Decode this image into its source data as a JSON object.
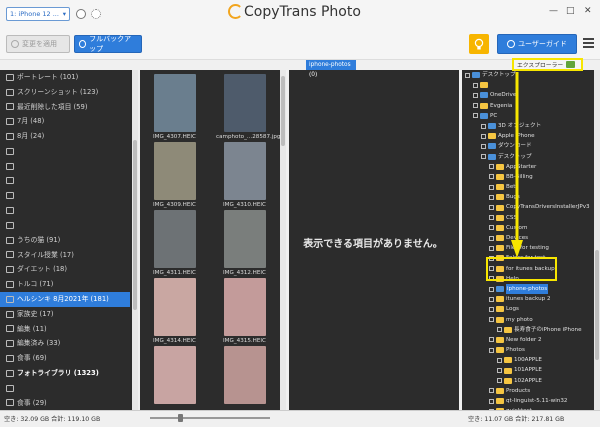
{
  "device": {
    "label": "1: iPhone 12 ..."
  },
  "app_title": "CopyTrans Photo",
  "toolbar": {
    "apply": "変更を適用",
    "backup": "フルバックアップ",
    "guide": "ユーザーガイド"
  },
  "albums": [
    {
      "label": "ポートレート (101)",
      "bold": false
    },
    {
      "label": "スクリーンショット (123)",
      "bold": false
    },
    {
      "label": "最近削除した項目 (59)",
      "bold": false
    },
    {
      "label": "7月 (48)",
      "bold": false
    },
    {
      "label": "8月 (24)",
      "bold": false
    },
    {
      "label": "",
      "bold": false
    },
    {
      "label": "",
      "bold": false
    },
    {
      "label": "",
      "bold": false
    },
    {
      "label": "",
      "bold": false
    },
    {
      "label": "",
      "bold": false
    },
    {
      "label": "",
      "bold": false
    },
    {
      "label": "うちの猫 (91)",
      "bold": false
    },
    {
      "label": "スタイル授業 (17)",
      "bold": false
    },
    {
      "label": "ダイエット (18)",
      "bold": false
    },
    {
      "label": "トルコ (71)",
      "bold": false
    },
    {
      "label": "ヘルシンキ 8月2021年 (181)",
      "bold": false,
      "selected": true
    },
    {
      "label": "家族史 (17)",
      "bold": false
    },
    {
      "label": "編集 (11)",
      "bold": false
    },
    {
      "label": "編集済み (33)",
      "bold": false
    },
    {
      "label": "食事 (69)",
      "bold": false
    },
    {
      "label": "フォトライブラリ (1323)",
      "bold": true
    },
    {
      "label": "",
      "bold": false
    },
    {
      "label": "食事 (29)",
      "bold": false
    }
  ],
  "thumbnails": [
    {
      "label": "IMG_4307.HEIC",
      "color": "#6a7e8e"
    },
    {
      "label": "camphoto_...28587.jpg",
      "color": "#4e5b6b"
    },
    {
      "label": "IMG_4309.HEIC",
      "color": "#8e8a78"
    },
    {
      "label": "IMG_4310.HEIC",
      "color": "#7c8590"
    },
    {
      "label": "IMG_4311.HEIC",
      "color": "#6d7275"
    },
    {
      "label": "IMG_4312.HEIC",
      "color": "#7a7e7c"
    },
    {
      "label": "IMG_4314.HEIC",
      "color": "#c9a7a2"
    },
    {
      "label": "IMG_4315.HEIC",
      "color": "#c39b9a"
    },
    {
      "label": "",
      "color": "#c8a4a2"
    },
    {
      "label": "",
      "color": "#b79390"
    }
  ],
  "middle": {
    "folder_tab": "iphone-photos (0)",
    "empty_message": "表示できる項目がありません。"
  },
  "explorer": {
    "label": "エクスプローラー"
  },
  "tree": [
    {
      "label": "デスクトップ",
      "indent": 0,
      "icon": "blue"
    },
    {
      "label": "",
      "indent": 1,
      "icon": "folder"
    },
    {
      "label": "OneDrive",
      "indent": 1,
      "icon": "blue"
    },
    {
      "label": "Evgenia",
      "indent": 1,
      "icon": "folder"
    },
    {
      "label": "PC",
      "indent": 1,
      "icon": "blue"
    },
    {
      "label": "3D オブジェクト",
      "indent": 2,
      "icon": "blue"
    },
    {
      "label": "Apple iPhone",
      "indent": 2,
      "icon": "folder"
    },
    {
      "label": "ダウンロード",
      "indent": 2,
      "icon": "blue"
    },
    {
      "label": "デスクトップ",
      "indent": 2,
      "icon": "blue"
    },
    {
      "label": "AppStarter",
      "indent": 3,
      "icon": "folder"
    },
    {
      "label": "BB-Billing",
      "indent": 3,
      "icon": "folder"
    },
    {
      "label": "Beta",
      "indent": 3,
      "icon": "folder"
    },
    {
      "label": "Bugs",
      "indent": 3,
      "icon": "folder"
    },
    {
      "label": "CopyTransDriversInstallerJPv3",
      "indent": 3,
      "icon": "folder"
    },
    {
      "label": "CSS",
      "indent": 3,
      "icon": "folder"
    },
    {
      "label": "Custom",
      "indent": 3,
      "icon": "folder"
    },
    {
      "label": "Devices",
      "indent": 3,
      "icon": "folder"
    },
    {
      "label": "Files for testing",
      "indent": 3,
      "icon": "folder"
    },
    {
      "label": "Folder for test",
      "indent": 3,
      "icon": "folder"
    },
    {
      "label": "for itunes backup",
      "indent": 3,
      "icon": "folder"
    },
    {
      "label": "Help",
      "indent": 3,
      "icon": "folder"
    },
    {
      "label": "iphone-photos",
      "indent": 3,
      "icon": "blue",
      "selected": true
    },
    {
      "label": "itunes backup 2",
      "indent": 3,
      "icon": "folder"
    },
    {
      "label": "Logs",
      "indent": 3,
      "icon": "folder"
    },
    {
      "label": "my photo",
      "indent": 3,
      "icon": "folder"
    },
    {
      "label": "長寿食子のiPhone iPhone",
      "indent": 4,
      "icon": "folder"
    },
    {
      "label": "New folder 2",
      "indent": 3,
      "icon": "folder"
    },
    {
      "label": "Photos",
      "indent": 3,
      "icon": "folder"
    },
    {
      "label": "100APPLE",
      "indent": 4,
      "icon": "folder"
    },
    {
      "label": "101APPLE",
      "indent": 4,
      "icon": "folder"
    },
    {
      "label": "102APPLE",
      "indent": 4,
      "icon": "folder"
    },
    {
      "label": "Products",
      "indent": 3,
      "icon": "folder"
    },
    {
      "label": "qt-linguist-5.11-win32",
      "indent": 3,
      "icon": "folder"
    },
    {
      "label": "quicktext",
      "indent": 3,
      "icon": "folder"
    },
    {
      "label": "res",
      "indent": 3,
      "icon": "folder"
    }
  ],
  "status": {
    "left": "空き: 32.09 GB 合計: 119.10 GB",
    "right": "空き: 11.07 GB 合計: 217.81 GB"
  },
  "colors": {
    "accent": "#2f7ddb",
    "highlight": "#f7e600",
    "panel": "#2c2c2c"
  }
}
